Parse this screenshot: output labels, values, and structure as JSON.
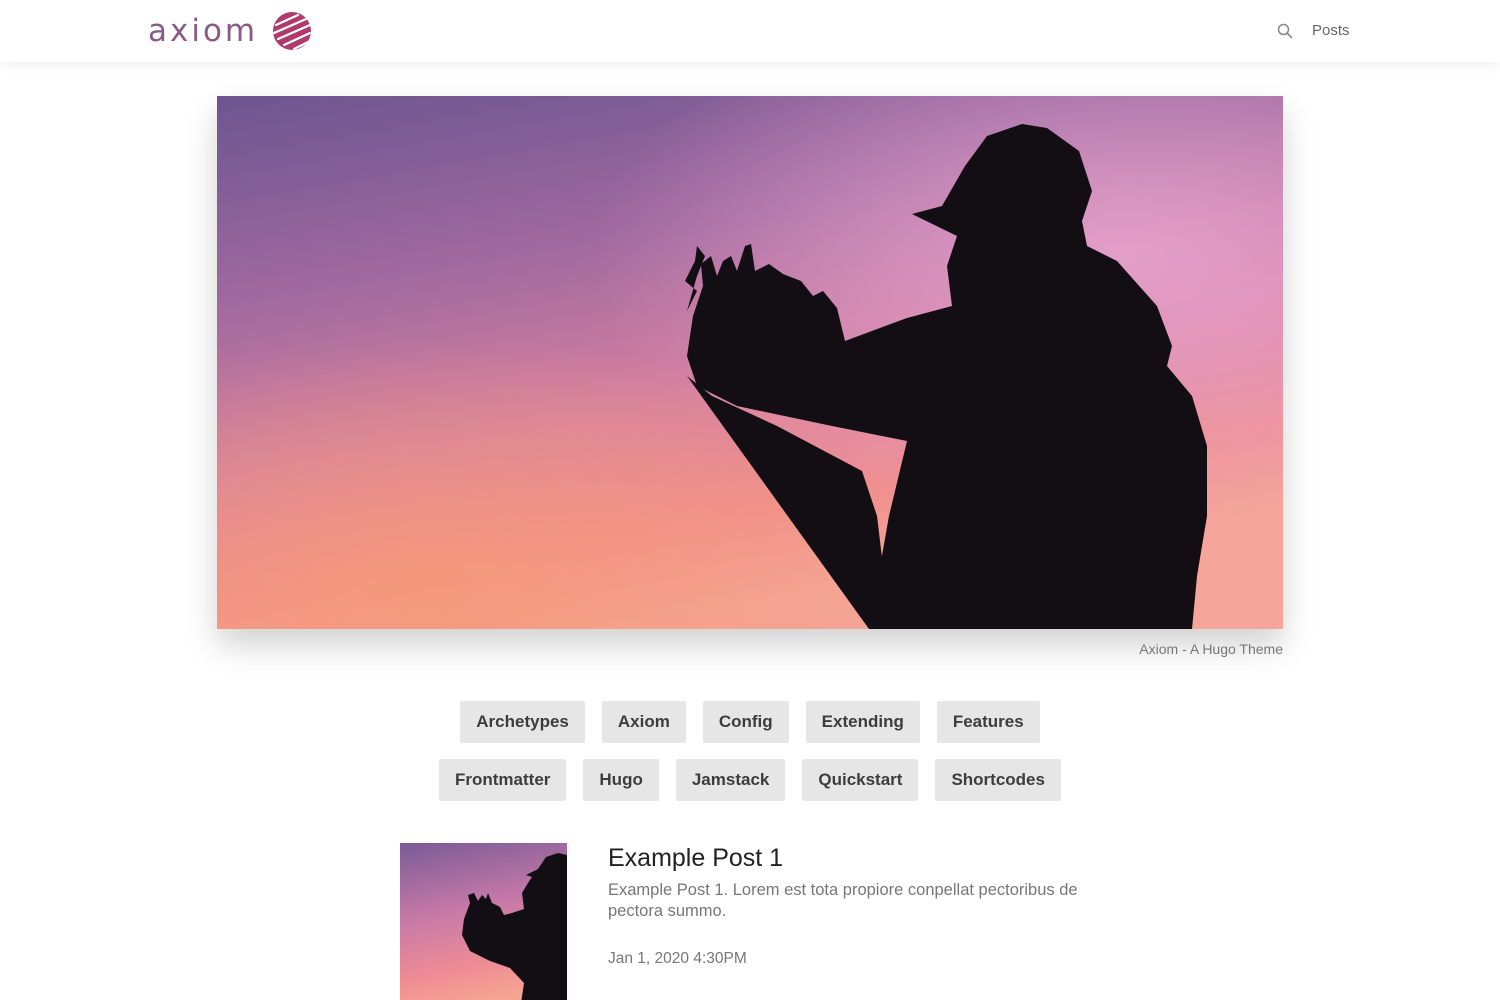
{
  "header": {
    "logo_text": "axiom",
    "logo_mark_icon": "axiom-globe-logo",
    "search_icon": "search-icon",
    "nav": [
      {
        "label": "Posts"
      }
    ]
  },
  "hero": {
    "image": "silhouette-photographer-sunset-sky",
    "caption": "Axiom - A Hugo Theme"
  },
  "tags": {
    "row1": [
      "Archetypes",
      "Axiom",
      "Config",
      "Extending",
      "Features"
    ],
    "row2": [
      "Frontmatter",
      "Hugo",
      "Jamstack",
      "Quickstart",
      "Shortcodes"
    ]
  },
  "posts": [
    {
      "title": "Example Post 1",
      "summary": "Example Post 1. Lorem est tota propiore conpellat pectoribus de pectora summo.",
      "date": "Jan 1, 2020 4:30PM",
      "thumbnail": "silhouette-photographer-sunset-sky"
    }
  ],
  "colors": {
    "brand": "#8a5a86",
    "logo_mark": "#b03a6e",
    "tag_bg": "#e6e6e6",
    "text_muted": "#777777"
  }
}
